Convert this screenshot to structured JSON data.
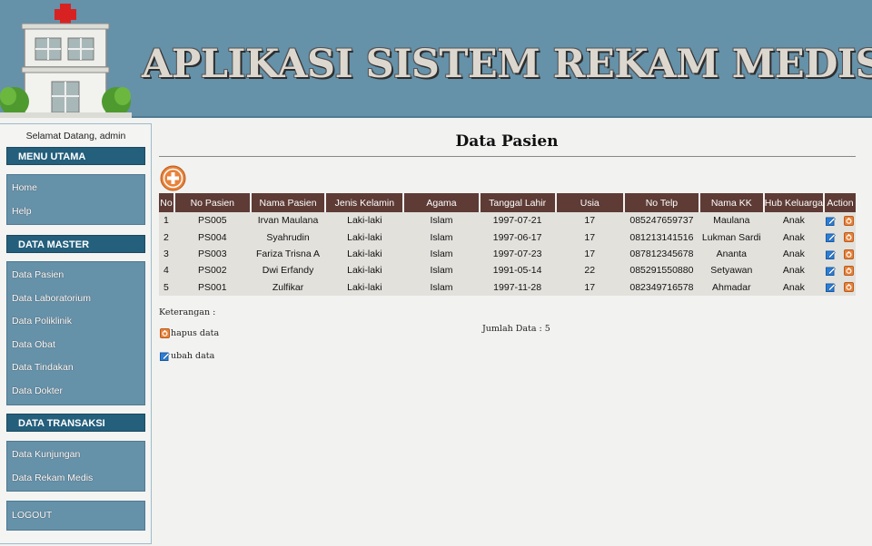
{
  "header": {
    "title": "APLIKASI SISTEM REKAM MEDIS"
  },
  "sidebar": {
    "welcome": "Selamat Datang, admin",
    "menu_utama": {
      "heading": "MENU UTAMA",
      "items": [
        "Home",
        "Help"
      ]
    },
    "data_master": {
      "heading": "DATA MASTER",
      "items": [
        "Data Pasien",
        "Data Laboratorium",
        "Data Poliklinik",
        "Data Obat",
        "Data Tindakan",
        "Data Dokter"
      ]
    },
    "data_transaksi": {
      "heading": "DATA TRANSAKSI",
      "items": [
        "Data Kunjungan",
        "Data Rekam Medis"
      ]
    },
    "logout": "LOGOUT"
  },
  "main": {
    "title": "Data Pasien",
    "columns": [
      "No",
      "No Pasien",
      "Nama Pasien",
      "Jenis Kelamin",
      "Agama",
      "Tanggal Lahir",
      "Usia",
      "No Telp",
      "Nama KK",
      "Hub Keluarga",
      "Action"
    ],
    "rows": [
      [
        "1",
        "PS005",
        "Irvan Maulana",
        "Laki-laki",
        "Islam",
        "1997-07-21",
        "17",
        "085247659737",
        "Maulana",
        "Anak"
      ],
      [
        "2",
        "PS004",
        "Syahrudin",
        "Laki-laki",
        "Islam",
        "1997-06-17",
        "17",
        "081213141516",
        "Lukman Sardi",
        "Anak"
      ],
      [
        "3",
        "PS003",
        "Fariza Trisna A",
        "Laki-laki",
        "Islam",
        "1997-07-23",
        "17",
        "087812345678",
        "Ananta",
        "Anak"
      ],
      [
        "4",
        "PS002",
        "Dwi Erfandy",
        "Laki-laki",
        "Islam",
        "1991-05-14",
        "22",
        "085291550880",
        "Setyawan",
        "Anak"
      ],
      [
        "5",
        "PS001",
        "Zulfikar",
        "Laki-laki",
        "Islam",
        "1997-11-28",
        "17",
        "082349716578",
        "Ahmadar",
        "Anak"
      ]
    ],
    "keterangan": "Keterangan :",
    "legend_hapus": "hapus data",
    "legend_ubah": "ubah data",
    "jumlah": "Jumlah Data : 5"
  },
  "colors": {
    "header_bg": "#6591a9",
    "menu_heading_bg": "#245f7c",
    "table_header_bg": "#5e3b35",
    "add_button": "#e8823a"
  },
  "icons": {
    "add": "plus-circle-icon",
    "edit": "pencil-edit-icon",
    "delete": "delete-icon",
    "logo": "hospital-building-icon"
  }
}
